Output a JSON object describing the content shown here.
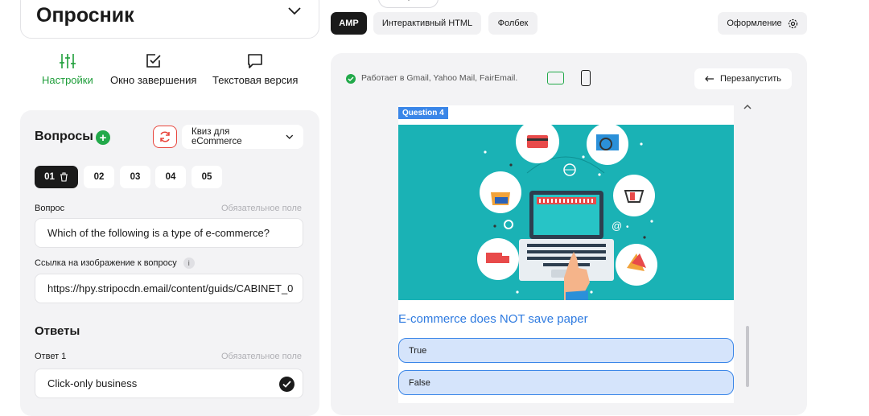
{
  "app": {
    "title": "Опросник"
  },
  "left_tabs": [
    {
      "label": "Настройки",
      "icon": "sliders-icon",
      "active": true
    },
    {
      "label": "Окно завершения",
      "icon": "checkbox-icon",
      "active": false
    },
    {
      "label": "Текстовая версия",
      "icon": "chat-icon",
      "active": false
    }
  ],
  "questions": {
    "heading": "Вопросы",
    "template_select": "Квиз для eCommerce",
    "numbers": [
      "01",
      "02",
      "03",
      "04",
      "05"
    ],
    "active_index": 0,
    "question_label": "Вопрос",
    "required_label": "Обязательное поле",
    "question_value": "Which of the following is a type of e-commerce?",
    "image_label": "Ссылка на изображение к вопросу",
    "image_info": "i",
    "image_value": "https://hpy.stripocdn.email/content/guids/CABINET_0",
    "answers_heading": "Ответы",
    "answer1_label": "Ответ 1",
    "answer1_required": "Обязательное поле",
    "answer1_value": "Click-only business"
  },
  "toolbar": {
    "tabs": [
      "AMP",
      "Интерактивный HTML",
      "Фолбек"
    ],
    "active_tab": "AMP",
    "design_label": "Оформление"
  },
  "preview": {
    "support_text": "Работает в Gmail, Yahoo Mail, FairEmail.",
    "restart_label": "Перезапустить",
    "question_badge": "Question 4",
    "question_text": "E-commerce does NOT save paper",
    "answers": [
      "True",
      "False"
    ],
    "accent_color": "#3a86e8",
    "hero_color": "#1ab2b5",
    "status_color": "#22a94a"
  }
}
